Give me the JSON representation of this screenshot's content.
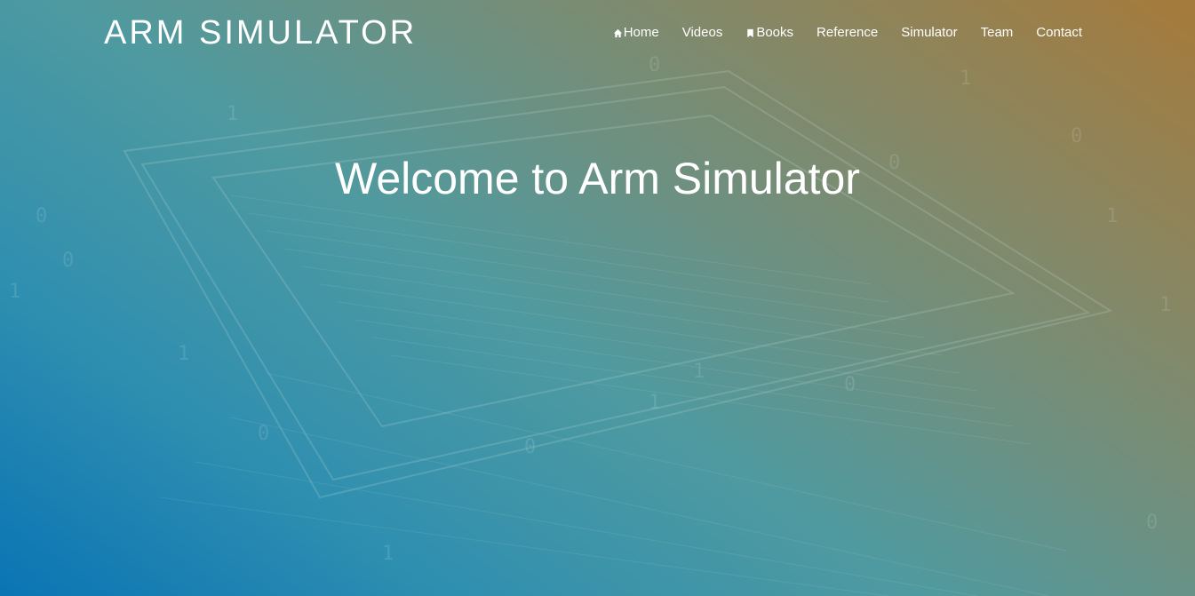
{
  "brand": {
    "title": "ARM SIMULATOR"
  },
  "nav": {
    "items": [
      {
        "label": "Home",
        "icon": "home-icon"
      },
      {
        "label": "Videos"
      },
      {
        "label": "Books",
        "icon": "bookmark-icon"
      },
      {
        "label": "Reference"
      },
      {
        "label": "Simulator"
      },
      {
        "label": "Team"
      },
      {
        "label": "Contact"
      }
    ]
  },
  "hero": {
    "heading": "Welcome to Arm Simulator"
  },
  "colors": {
    "gradient_start": "#0a74b4",
    "gradient_mid": "#4f9aa0",
    "gradient_end": "#a67a3a",
    "text": "#ffffff"
  }
}
